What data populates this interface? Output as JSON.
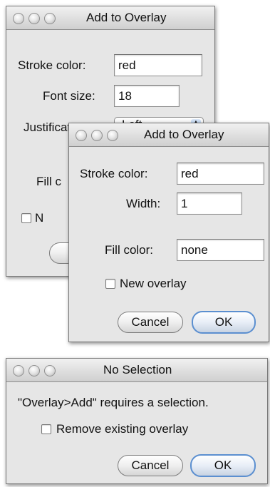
{
  "dialog_text": {
    "title": "Add to Overlay",
    "stroke_color_label": "Stroke color:",
    "stroke_color_value": "red",
    "font_size_label": "Font size:",
    "font_size_value": "18",
    "justification_label": "Justification:",
    "justification_value": "Left",
    "fill_color_label_partial": "Fill c",
    "new_overlay_partial": "N",
    "button_partial": "("
  },
  "dialog_line": {
    "title": "Add to Overlay",
    "stroke_color_label": "Stroke color:",
    "stroke_color_value": "red",
    "width_label": "Width:",
    "width_value": "1",
    "fill_color_label": "Fill color:",
    "fill_color_value": "none",
    "new_overlay_label": "New overlay",
    "cancel_label": "Cancel",
    "ok_label": "OK"
  },
  "dialog_nosel": {
    "title": "No Selection",
    "message": "\"Overlay>Add\" requires a selection.",
    "remove_label": "Remove existing overlay",
    "cancel_label": "Cancel",
    "ok_label": "OK"
  },
  "icons": {
    "window_controls": "traffic-light-graphite",
    "popup_arrow": "up-down-stepper-arrows",
    "checkbox": "unchecked-checkbox"
  },
  "colors": {
    "window_bg": "#e6e6e6",
    "default_button_border": "#5b8fd0"
  }
}
